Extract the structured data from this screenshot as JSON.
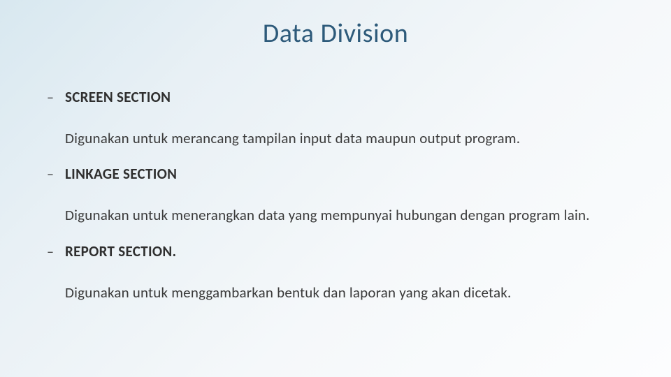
{
  "title": "Data Division",
  "sections": [
    {
      "heading": "SCREEN SECTION",
      "desc": "Digunakan untuk merancang tampilan input data maupun output program."
    },
    {
      "heading": "LINKAGE SECTION",
      "desc": "Digunakan untuk menerangkan data yang mempunyai hubungan dengan program lain."
    },
    {
      "heading": "REPORT SECTION.",
      "desc": "Digunakan untuk menggambarkan bentuk dan laporan yang akan dicetak."
    }
  ],
  "bullet": "–"
}
